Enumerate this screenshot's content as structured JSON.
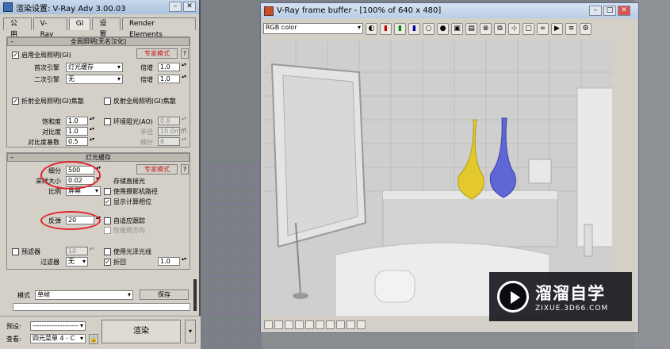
{
  "render_dialog": {
    "title": "渲染设置: V-Ray Adv 3.00.03",
    "tabs": [
      "公用",
      "V-Ray",
      "GI",
      "设置",
      "Render Elements"
    ],
    "active_tab": "GI",
    "gi_rollout": {
      "header": "全局照明[无名汉化]",
      "enable_gi_label": "启用全局照明(GI)",
      "expert_mode_label": "专家模式",
      "help_label": "?",
      "primary_engine_label": "首次引擎",
      "primary_engine_value": "灯光缓存",
      "secondary_engine_label": "二次引擎",
      "secondary_engine_value": "无",
      "multiplier_label": "倍增",
      "primary_multiplier": "1.0",
      "secondary_multiplier": "1.0",
      "refractive_caustics_label": "折射全局照明(GI)焦散",
      "reflective_caustics_label": "反射全局照明(GI)焦散",
      "saturation_label": "饱和度",
      "saturation_value": "1.0",
      "contrast_label": "对比度",
      "contrast_value": "1.0",
      "contrast_base_label": "对比度基数",
      "contrast_base_value": "0.5",
      "ao_label": "环境阻光(AO)",
      "ao_value": "0.8",
      "radius_label": "半径",
      "radius_value": "10.0mm",
      "subdivs_label": "细分",
      "ao_subdivs_value": "8"
    },
    "light_cache_rollout": {
      "header": "灯光缓存",
      "expert_mode_label": "专家模式",
      "help_label": "?",
      "subdivs_label": "细分",
      "subdivs_value": "500",
      "sample_size_label": "采样大小",
      "sample_size_value": "0.02",
      "scale_label": "比例",
      "scale_value": "屏幕",
      "store_direct_label": "存储直接光",
      "use_camera_path_label": "使用摄影机路径",
      "show_calc_label": "显示计算相位",
      "bounces_label": "反弹",
      "bounces_value": "20",
      "adaptive_tracing_label": "自适应跟踪",
      "directions_only_label": "仅使用方向",
      "prefilter_label": "预滤器",
      "prefilter_value": "10",
      "use_for_glossy_label": "使用光泽光线",
      "filter_label": "过滤器",
      "filter_value": "无",
      "retrace_label": "折回",
      "retrace_value": "1.0"
    },
    "mode_label": "模式",
    "mode_value": "单帧",
    "save_label": "保存",
    "preset_label": "预设:",
    "preset_value": "--------------------",
    "view_label": "查看:",
    "view_value": "四元菜单 4 - C",
    "render_label": "渲染"
  },
  "frame_buffer": {
    "title": "V-Ray frame buffer - [100% of 640 x 480]",
    "channel_value": "RGB color"
  },
  "watermark": {
    "brand_cn": "溜溜自学",
    "brand_url": "ZIXUE.3D66.COM"
  }
}
